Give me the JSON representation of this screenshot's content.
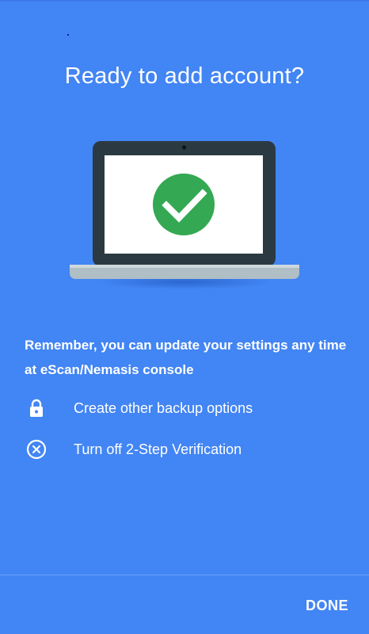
{
  "header": {
    "title": "Ready to add account?"
  },
  "illustration": {
    "icon": "laptop-with-check-icon",
    "check_color": "#34a853"
  },
  "message": {
    "text": "Remember, you can update your settings any time at eScan/Nemasis console"
  },
  "options": [
    {
      "icon": "lock-icon",
      "label": "Create other backup options"
    },
    {
      "icon": "cancel-circle-icon",
      "label": "Turn off 2-Step Verification"
    }
  ],
  "footer": {
    "done_label": "DONE"
  },
  "colors": {
    "background": "#4285f4",
    "text": "#ffffff",
    "laptop_frame": "#2b3a42",
    "laptop_base": "#b0bec5"
  }
}
